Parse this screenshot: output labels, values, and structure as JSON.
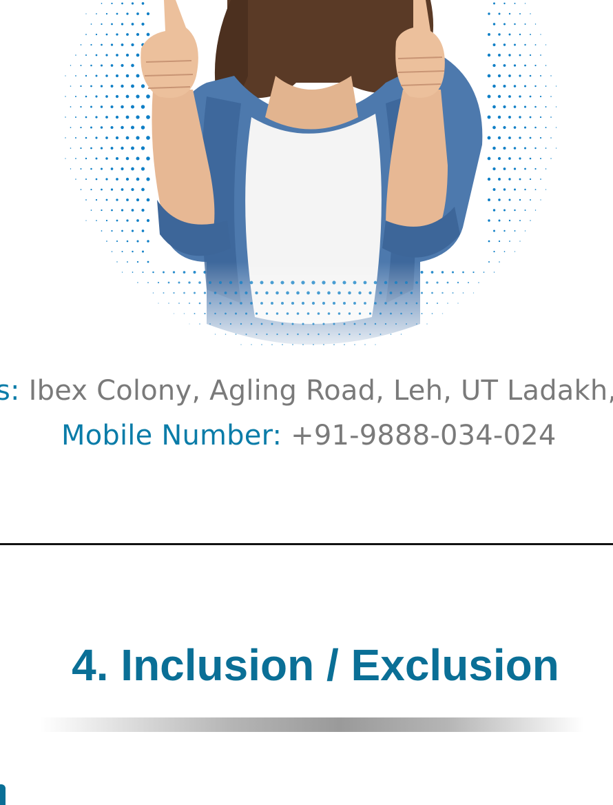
{
  "contact": {
    "address_label": "s:",
    "address_value": "Ibex Colony, Agling Road, Leh, UT Ladakh,",
    "mobile_label": "Mobile Number:",
    "mobile_value": "+91-9888-034-024"
  },
  "section": {
    "title": "4. Inclusion / Exclusion"
  },
  "colors": {
    "accent_blue": "#0a7ca8",
    "title_blue": "#0a6f96",
    "body_gray": "#7a7a7a",
    "halftone_blue": "#0f7fc6"
  },
  "hero": {
    "icon": "thumbs-up-woman-photo"
  }
}
